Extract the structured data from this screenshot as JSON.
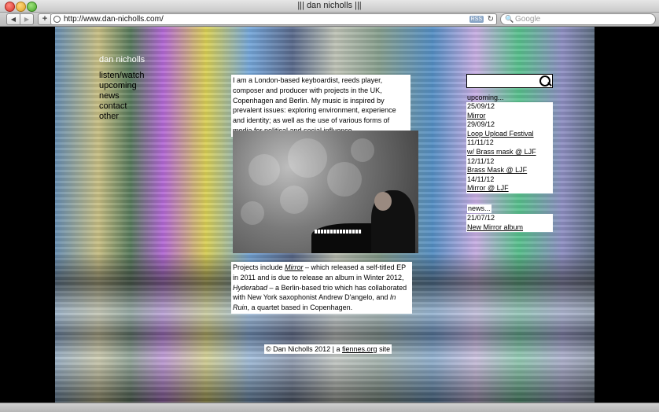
{
  "window": {
    "title": "||| dan nicholls |||"
  },
  "toolbar": {
    "back_icon": "back-arrow-icon",
    "forward_icon": "forward-arrow-icon",
    "add_label": "+",
    "url": "http://www.dan-nicholls.com/",
    "rss_label": "RSS",
    "search_placeholder": "Google"
  },
  "site": {
    "name": "dan nicholls",
    "nav": [
      "listen/watch",
      "upcoming",
      "news",
      "contact",
      "other"
    ]
  },
  "content": {
    "intro": "I am a London-based keyboardist, reeds player, composer and producer with projects in the UK, Copenhagen and Berlin. My music is inspired by prevalent issues: exploring environment, experience and identity; as well as the use of various forms of media for political and social influence.",
    "projects": {
      "p1": "Projects include ",
      "mirror": "Mirror",
      "p2": " – which released a self-titled EP in 2011 and is due to release an album in Winter 2012, ",
      "hyderabad": "Hyderabad",
      "p3": " – a Berlin-based trio which has collaborated with New York saxophonist Andrew D'angelo, and ",
      "inruin": "In Ruin",
      "p4": ", a quartet based in Copenhagen."
    },
    "footer": {
      "prefix": "© Dan Nicholls 2012 | a ",
      "link": "fiennes.org",
      "suffix": " site"
    }
  },
  "sidebar": {
    "upcoming_label": "upcoming...",
    "events": [
      {
        "date": "25/09/12",
        "title": "Mirror"
      },
      {
        "date": "29/09/12",
        "title": "Loop Upload Festival"
      },
      {
        "date": "11/11/12",
        "title": "w/ Brass mask @ LJF"
      },
      {
        "date": "12/11/12",
        "title": "Brass Mask @ LJF"
      },
      {
        "date": "14/11/12",
        "title": "Mirror @ LJF"
      }
    ],
    "news_label": "news...",
    "news": [
      {
        "date": "21/07/12",
        "title": "New Mirror album"
      }
    ]
  }
}
